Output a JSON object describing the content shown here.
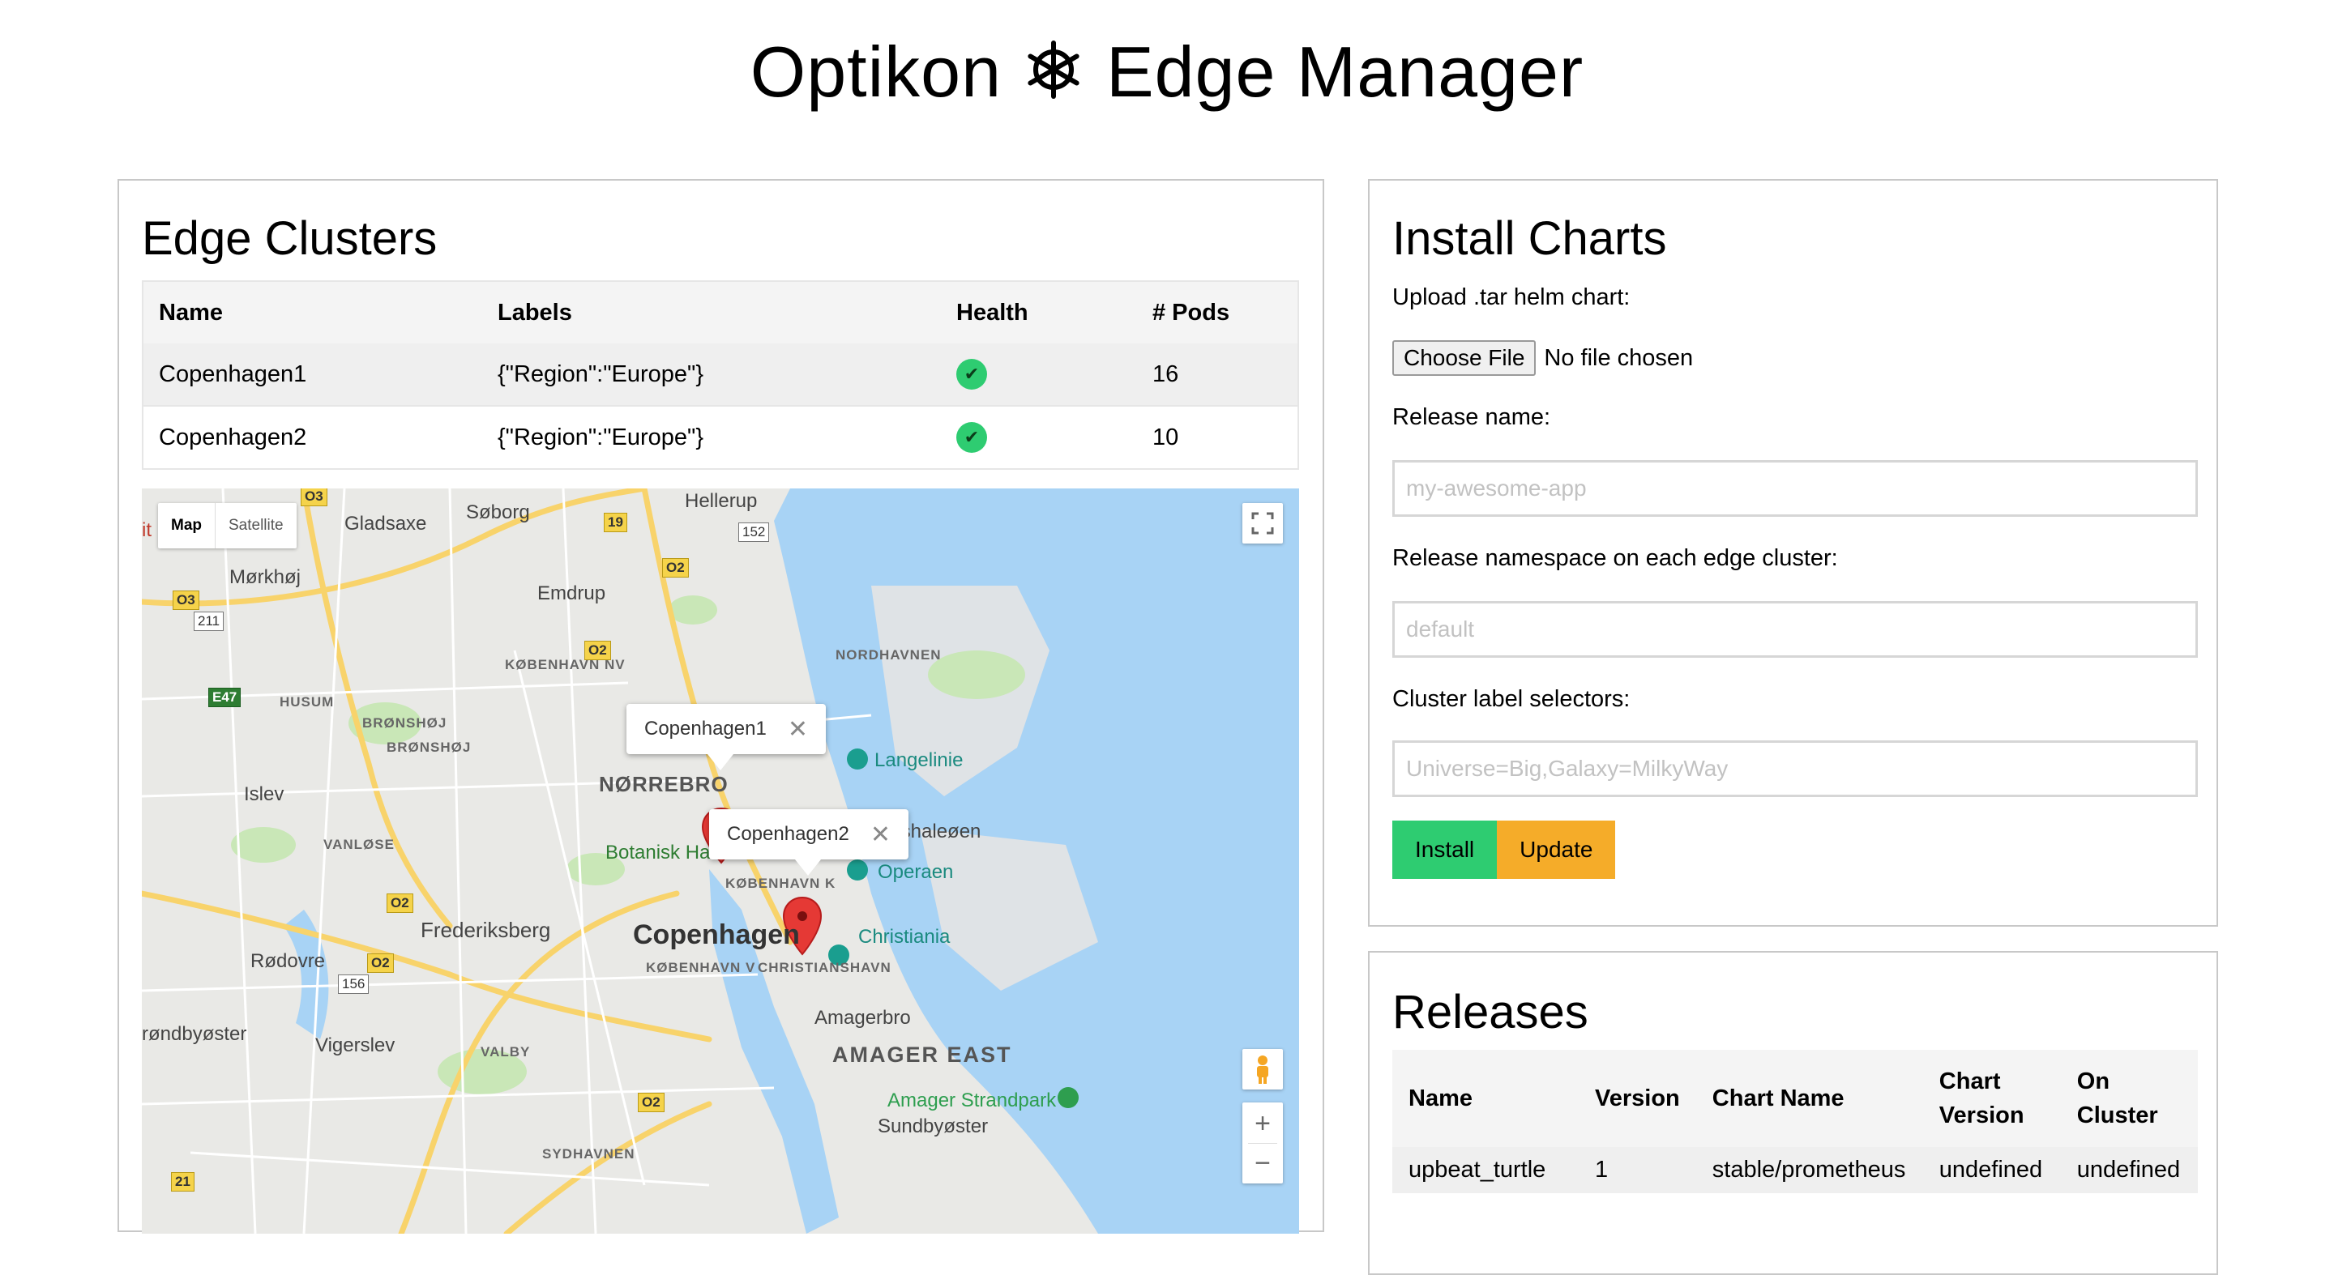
{
  "header": {
    "title_left": "Optikon",
    "title_right": "Edge Manager",
    "logo_icon": "helm-wheel-icon"
  },
  "clusters": {
    "title": "Edge Clusters",
    "columns": [
      "Name",
      "Labels",
      "Health",
      "# Pods"
    ],
    "rows": [
      {
        "name": "Copenhagen1",
        "labels": "{\"Region\":\"Europe\"}",
        "health": "✔",
        "pods": "16"
      },
      {
        "name": "Copenhagen2",
        "labels": "{\"Region\":\"Europe\"}",
        "health": "✔",
        "pods": "10"
      }
    ],
    "health_color": "#2ecc71"
  },
  "map": {
    "type_control": {
      "map": "Map",
      "satellite": "Satellite"
    },
    "markers": [
      {
        "label": "Copenhagen1"
      },
      {
        "label": "Copenhagen2"
      }
    ],
    "labels": {
      "hellerup": "Hellerup",
      "gladsaxe": "Gladsaxe",
      "soborg": "Søborg",
      "morkhoj": "Mørkhøj",
      "emdrup": "Emdrup",
      "kbh_nv": "KØBENHAVN NV",
      "nordhavnen": "NORDHAVNEN",
      "husum": "HUSUM",
      "bronshoj_upper": "BRØNSHØJ",
      "bronshoj_lower": "BRØNSHØJ",
      "langelinie": "Langelinie",
      "norrebro": "NØRREBRO",
      "islev": "Islev",
      "fshaleoen": "fshaleøen",
      "vanlose": "VANLØSE",
      "botanisk": "Botanisk Ha",
      "kbh_k": "KØBENHAVN K",
      "operaen": "Operaen",
      "frederiksberg": "Frederiksberg",
      "copenhagen": "Copenhagen",
      "christiania": "Christiania",
      "rodovre": "Rødovre",
      "kbh_v": "KØBENHAVN V",
      "christianshavn": "CHRISTIANSHAVN",
      "amagerbro": "Amagerbro",
      "rondbyoster": "røndbyøster",
      "amager_east": "AMAGER EAST",
      "valby": "VALBY",
      "vigerslev": "Vigerslev",
      "amager_strandpark": "Amager Strandpark",
      "sundbyoster": "Sundbyøster",
      "sydhavnen": "SYDHAVNEN",
      "edge_it": "it"
    },
    "shields": {
      "o3_top": "O3",
      "o19": "19",
      "o152": "152",
      "o2_a": "O2",
      "o3_left": "O3",
      "o211": "211",
      "o2_b": "O2",
      "e47": "E47",
      "o2_c": "O2",
      "o2_d": "O2",
      "o156": "156",
      "o2_e": "O2",
      "o21": "21"
    },
    "colors": {
      "water": "#a8d3f5",
      "land": "#e9e9e6",
      "park": "#c9e7b7",
      "highway": "#f8d36b",
      "marker": "#e53935"
    }
  },
  "install": {
    "title": "Install Charts",
    "upload_label": "Upload .tar helm chart:",
    "choose_file": "Choose File",
    "no_file": "No file chosen",
    "release_name_label": "Release name:",
    "release_name_placeholder": "my-awesome-app",
    "namespace_label": "Release namespace on each edge cluster:",
    "namespace_placeholder": "default",
    "selectors_label": "Cluster label selectors:",
    "selectors_placeholder": "Universe=Big,Galaxy=MilkyWay",
    "install_button": "Install",
    "update_button": "Update",
    "install_color": "#2ecc71",
    "update_color": "#f5ac29"
  },
  "releases": {
    "title": "Releases",
    "columns": {
      "name": "Name",
      "version": "Version",
      "chart_name": "Chart Name",
      "chart_version_1": "Chart",
      "chart_version_2": "Version",
      "on_cluster_1": "On",
      "on_cluster_2": "Cluster"
    },
    "rows": [
      {
        "name": "upbeat_turtle",
        "version": "1",
        "chart_name": "stable/prometheus",
        "chart_version": "undefined",
        "on_cluster": "undefined"
      }
    ]
  }
}
